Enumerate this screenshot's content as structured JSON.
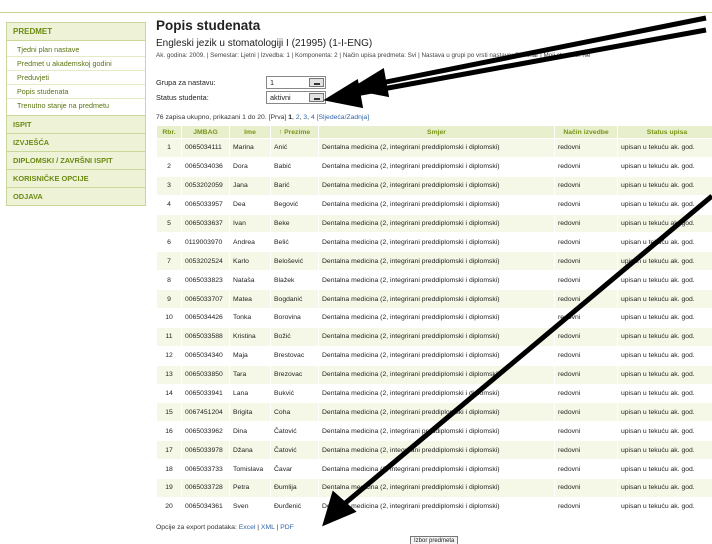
{
  "sidebar": {
    "header": "PREDMET",
    "items": [
      "Tjedni plan nastave",
      "Predmet u akademskoj godini",
      "Preduvjeti",
      "Popis studenata",
      "Trenutno stanje na predmetu"
    ],
    "sections": [
      "ISPIT",
      "IZVJEŠĆA",
      "DIPLOMSKI / ZAVRŠNI ISPIT",
      "KORISNIČKE OPCIJE",
      "ODJAVA"
    ]
  },
  "main": {
    "title": "Popis studenata",
    "subtitle": "Engleski jezik u stomatologiji I (21995) (1-I-ENG)",
    "meta": "Ak. godina: 2009. | Semestar: Ljetni | Izvedba: 1 | Komponenta: 2 | Način upisa predmeta: Svi | Nastava u grupi po vrsti nastave: Seminar | Moji studenti: Ne",
    "group_label": "Grupa za nastavu:",
    "group_value": "1",
    "status_label": "Status studenta:",
    "status_value": "aktivni",
    "count_text": "76 zapisa ukupno, prikazani 1 do 20. [Prva]",
    "page_current": "1",
    "page_links": [
      "2",
      "3",
      "4"
    ],
    "page_nav": "[Sljedeća/Zadnja]",
    "export_label": "Opcije za export podataka:",
    "export_links": [
      "Excel",
      "XML",
      "PDF"
    ],
    "bottom_button": "Izbor predmeta"
  },
  "table": {
    "headers": [
      "Rbr.",
      "JMBAG",
      "Ime",
      "↑ Prezime",
      "Smjer",
      "Način izvedbe",
      "Status upisa"
    ],
    "rows": [
      [
        "1",
        "0065034111",
        "Marina",
        "Anić",
        "Dentalna medicina (2, integrirani preddiplomski i diplomski)",
        "redovni",
        "upisan u tekuću ak. god."
      ],
      [
        "2",
        "0065034036",
        "Dora",
        "Babić",
        "Dentalna medicina (2, integrirani preddiplomski i diplomski)",
        "redovni",
        "upisan u tekuću ak. god."
      ],
      [
        "3",
        "0053202059",
        "Jana",
        "Barić",
        "Dentalna medicina (2, integrirani preddiplomski i diplomski)",
        "redovni",
        "upisan u tekuću ak. god."
      ],
      [
        "4",
        "0065033957",
        "Dea",
        "Begović",
        "Dentalna medicina (2, integrirani preddiplomski i diplomski)",
        "redovni",
        "upisan u tekuću ak. god."
      ],
      [
        "5",
        "0065033637",
        "Ivan",
        "Beke",
        "Dentalna medicina (2, integrirani preddiplomski i diplomski)",
        "redovni",
        "upisan u tekuću ak. god."
      ],
      [
        "6",
        "0119003970",
        "Andrea",
        "Belić",
        "Dentalna medicina (2, integrirani preddiplomski i diplomski)",
        "redovni",
        "upisan u tekuću ak. god."
      ],
      [
        "7",
        "0053202524",
        "Karlo",
        "Belošević",
        "Dentalna medicina (2, integrirani preddiplomski i diplomski)",
        "redovni",
        "upisan u tekuću ak. god."
      ],
      [
        "8",
        "0065033823",
        "Nataša",
        "Blažek",
        "Dentalna medicina (2, integrirani preddiplomski i diplomski)",
        "redovni",
        "upisan u tekuću ak. god."
      ],
      [
        "9",
        "0065033707",
        "Matea",
        "Bogdanić",
        "Dentalna medicina (2, integrirani preddiplomski i diplomski)",
        "redovni",
        "upisan u tekuću ak. god."
      ],
      [
        "10",
        "0065034426",
        "Tonka",
        "Borovina",
        "Dentalna medicina (2, integrirani preddiplomski i diplomski)",
        "redovni",
        "upisan u tekuću ak. god."
      ],
      [
        "11",
        "0065033588",
        "Kristina",
        "Božić",
        "Dentalna medicina (2, integrirani preddiplomski i diplomski)",
        "redovni",
        "upisan u tekuću ak. god."
      ],
      [
        "12",
        "0065034340",
        "Maja",
        "Brestovac",
        "Dentalna medicina (2, integrirani preddiplomski i diplomski)",
        "redovni",
        "upisan u tekuću ak. god."
      ],
      [
        "13",
        "0065033850",
        "Tara",
        "Brezovac",
        "Dentalna medicina (2, integrirani preddiplomski i diplomski)",
        "redovni",
        "upisan u tekuću ak. god."
      ],
      [
        "14",
        "0065033941",
        "Lana",
        "Bukvić",
        "Dentalna medicina (2, integrirani preddiplomski i diplomski)",
        "redovni",
        "upisan u tekuću ak. god."
      ],
      [
        "15",
        "0067451204",
        "Brigita",
        "Coha",
        "Dentalna medicina (2, integrirani preddiplomski i diplomski)",
        "redovni",
        "upisan u tekuću ak. god."
      ],
      [
        "16",
        "0065033962",
        "Dina",
        "Čatović",
        "Dentalna medicina (2, integrirani preddiplomski i diplomski)",
        "redovni",
        "upisan u tekuću ak. god."
      ],
      [
        "17",
        "0065033978",
        "Džana",
        "Čatović",
        "Dentalna medicina (2, integrirani preddiplomski i diplomski)",
        "redovni",
        "upisan u tekuću ak. god."
      ],
      [
        "18",
        "0065033733",
        "Tomislava",
        "Čavar",
        "Dentalna medicina (2, integrirani preddiplomski i diplomski)",
        "redovni",
        "upisan u tekuću ak. god."
      ],
      [
        "19",
        "0065033728",
        "Petra",
        "Đumlija",
        "Dentalna medicina (2, integrirani preddiplomski i diplomski)",
        "redovni",
        "upisan u tekuću ak. god."
      ],
      [
        "20",
        "0065034361",
        "Sven",
        "Đurđenić",
        "Dentalna medicina (2, integrirani preddiplomski i diplomski)",
        "redovni",
        "upisan u tekuću ak. god."
      ]
    ]
  },
  "colors": {
    "accent_green": "#6b8a12",
    "header_bg": "#e8efcc",
    "row_alt_bg": "#f5f8e6",
    "link_blue": "#3366aa",
    "annotation_arrow": "#000000"
  }
}
